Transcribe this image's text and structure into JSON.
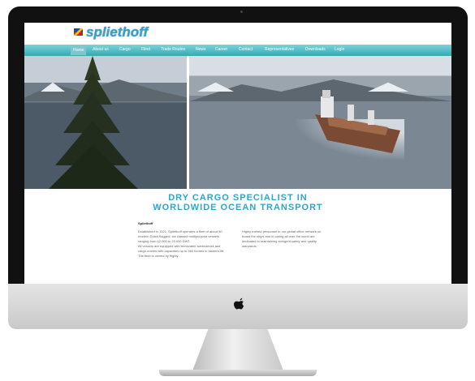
{
  "site": {
    "logo_text": "spliethoff",
    "nav": [
      "Home",
      "About us",
      "Cargo",
      "Fleet",
      "Trade Routes",
      "News",
      "Career",
      "Contact",
      "Representatives",
      "Downloads",
      "Login"
    ]
  },
  "headline": {
    "line1": "DRY CARGO SPECIALIST IN",
    "line2": "WORLDWIDE OCEAN TRANSPORT"
  },
  "content": {
    "title": "Spliethoff",
    "col1_p1": "Established in 1921, Spliethoff operates a fleet of about 50 modern Dutch flagged, ice classed multipurpose vessels ranging from 12.000 to 23.000 DWT.",
    "col1_p2": "All vessels are equipped with removable tweendecks and cargo cranes with capacities up to 360 tonnes in tandem lift. The fleet is owned by highly",
    "col2_p1": "Highly trained personnel in our global office network on board the ships and in caring all over the world are dedicated to maintaining stringent safety and quality standards."
  }
}
